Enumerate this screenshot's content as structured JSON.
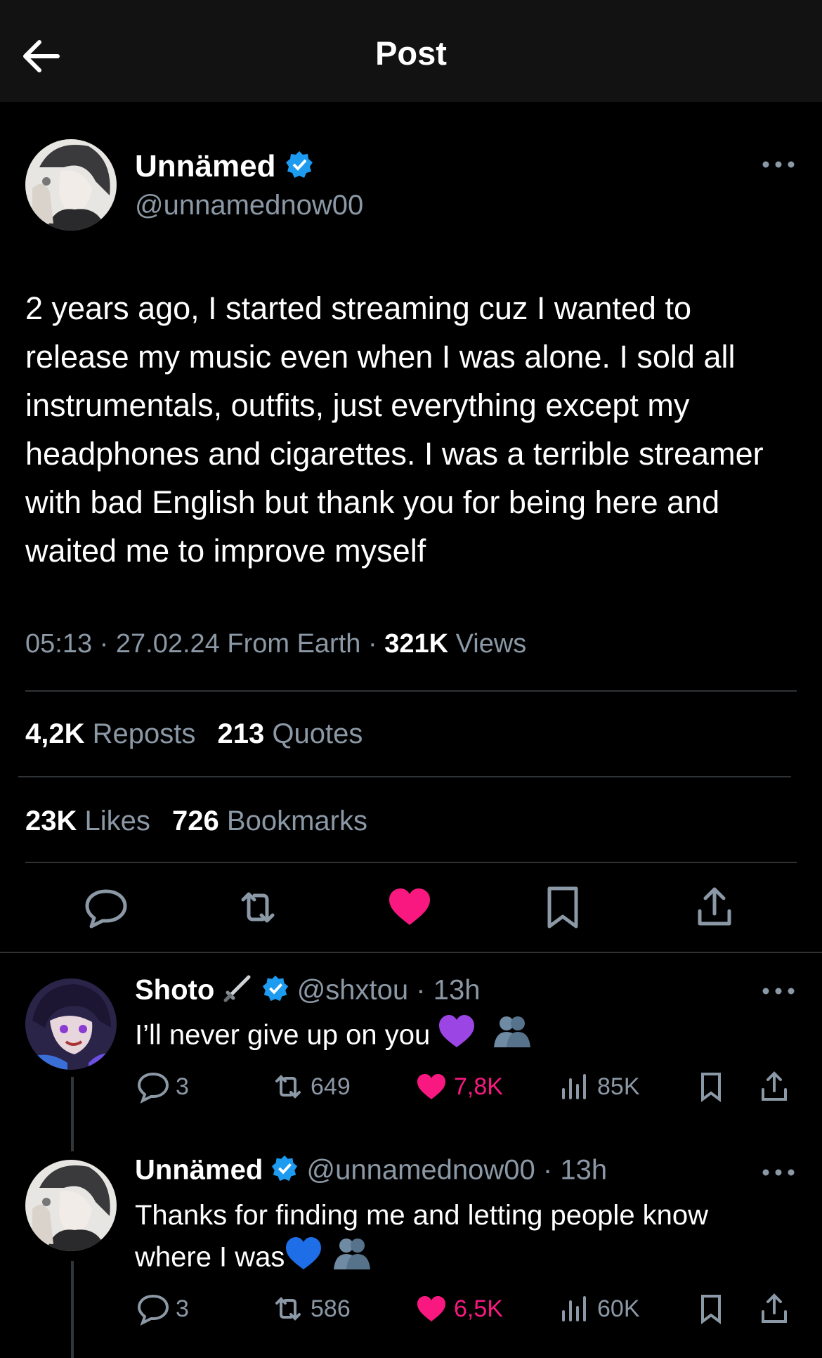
{
  "header": {
    "title": "Post"
  },
  "post": {
    "author_name": "Unnämed",
    "author_handle": "@unnamednow00",
    "text": "2 years ago, I started streaming cuz I wanted to release my music even when I was alone. I sold all instrumentals, outfits, just everything except my headphones and cigarettes. I was a terrible streamer with bad English but thank you for being here and waited me to improve myself",
    "time": "05:13",
    "date": "27.02.24",
    "source": "From Earth",
    "views_count": "321K",
    "views_label": "Views",
    "reposts_count": "4,2K",
    "reposts_label": "Reposts",
    "quotes_count": "213",
    "quotes_label": "Quotes",
    "likes_count": "23K",
    "likes_label": "Likes",
    "bookmarks_count": "726",
    "bookmarks_label": "Bookmarks"
  },
  "replies": [
    {
      "name": "Shoto",
      "handle": "@shxtou",
      "age": "13h",
      "text": "I’ll never give up on you",
      "replies": "3",
      "reposts": "649",
      "likes": "7,8K",
      "views": "85K"
    },
    {
      "name": "Unnämed",
      "handle": "@unnamednow00",
      "age": "13h",
      "text": "Thanks for finding me and letting people know where I was",
      "replies": "3",
      "reposts": "586",
      "likes": "6,5K",
      "views": "60K"
    }
  ],
  "colors": {
    "verified": "#1d9bf0",
    "like": "#f91880",
    "muted": "#8b98a5"
  },
  "icons": [
    "back-arrow-icon",
    "verified-badge-icon",
    "more-icon",
    "reply-icon",
    "repost-icon",
    "like-icon",
    "bookmark-icon",
    "share-icon",
    "views-icon",
    "sword-emoji-icon",
    "purple-heart-emoji-icon",
    "blue-heart-emoji-icon",
    "people-emoji-icon"
  ]
}
